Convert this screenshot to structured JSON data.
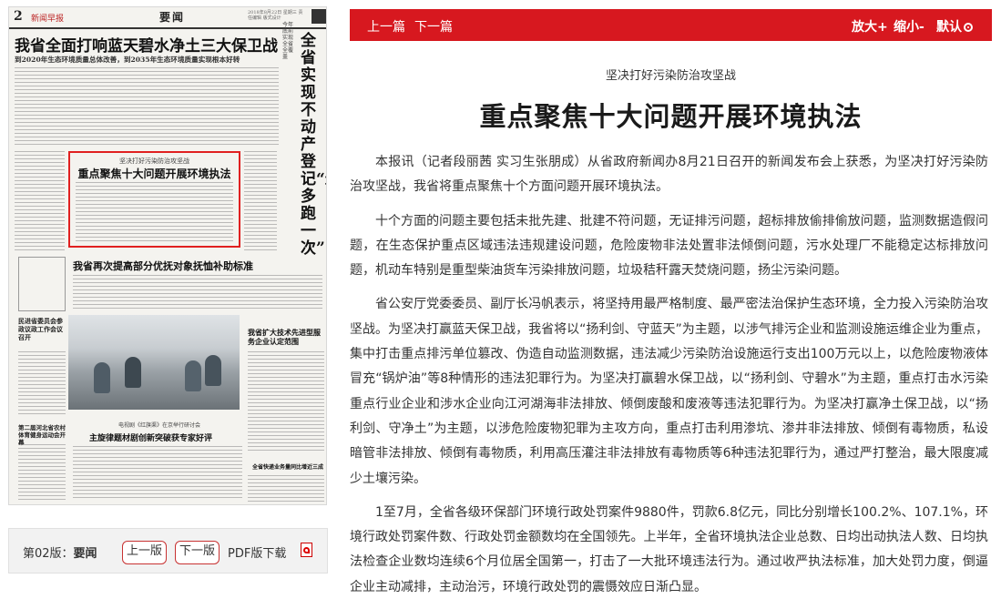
{
  "paper": {
    "page_no": "2",
    "name": "新闻早报",
    "section": "要闻",
    "header_small": "2018年8月22日 星期三 责任编辑 版式设计",
    "lead_headline": "我省全面打响蓝天碧水净土三大保卫战",
    "lead_subhead": "到2020年生态环境质量总体改善，到2035年生态环境质量实现根本好转",
    "vertical_headline": "全省实现不动产登记“最多跑一次”",
    "vertical_sub": "今年底前实现全省全覆盖",
    "highlight_kicker": "坚决打好污染防治攻坚战",
    "highlight_title": "重点聚焦十大问题开展环境执法",
    "third_headline": "我省再次提高部分优抚对象抚恤补助标准",
    "photo_side": "民进省委员会参政议政工作会议召开",
    "right_mid": "我省扩大技术先进型服务企业认定范围",
    "bottom_kicker": "电视剧《红旗渠》在京举行研讨会",
    "bottom_headline": "主旋律题材剧创新突破获专家好评",
    "bottom_right": "全省快递业务量同比增近三成",
    "bottom_left": "第二届河北省农村体育健身运动会开幕"
  },
  "pager": {
    "edition_label": "第02版：",
    "edition_name": "要闻",
    "prev": "上一版",
    "next": "下一版",
    "pdf": "PDF版下载"
  },
  "toolbar": {
    "prev": "上一篇",
    "next": "下一篇",
    "zoom_in": "放大+",
    "zoom_out": "缩小-",
    "default": "默认"
  },
  "article": {
    "kicker": "坚决打好污染防治攻坚战",
    "title": "重点聚焦十大问题开展环境执法",
    "paragraphs": [
      "本报讯（记者段丽茜 实习生张朋成）从省政府新闻办8月21日召开的新闻发布会上获悉，为坚决打好污染防治攻坚战，我省将重点聚焦十个方面问题开展环境执法。",
      "十个方面的问题主要包括未批先建、批建不符问题，无证排污问题，超标排放偷排偷放问题，监测数据造假问题，在生态保护重点区域违法违规建设问题，危险废物非法处置非法倾倒问题，污水处理厂不能稳定达标排放问题，机动车特别是重型柴油货车污染排放问题，垃圾秸秆露天焚烧问题，扬尘污染问题。",
      "省公安厅党委委员、副厅长冯帆表示，将坚持用最严格制度、最严密法治保护生态环境，全力投入污染防治攻坚战。为坚决打赢蓝天保卫战，我省将以“扬利剑、守蓝天”为主题，以涉气排污企业和监测设施运维企业为重点，集中打击重点排污单位篡改、伪造自动监测数据，违法减少污染防治设施运行支出100万元以上，以危险废物液体冒充“锅炉油”等8种情形的违法犯罪行为。为坚决打赢碧水保卫战，以“扬利剑、守碧水”为主题，重点打击水污染重点行业企业和涉水企业向江河湖海非法排放、倾倒废酸和废液等违法犯罪行为。为坚决打赢净土保卫战，以“扬利剑、守净土”为主题，以涉危险废物犯罪为主攻方向，重点打击利用渗坑、渗井非法排放、倾倒有毒物质，私设暗管非法排放、倾倒有毒物质，利用高压灌注非法排放有毒物质等6种违法犯罪行为，通过严打整治，最大限度减少土壤污染。",
      "1至7月，全省各级环保部门环境行政处罚案件9880件，罚款6.8亿元，同比分别增长100.2%、107.1%，环境行政处罚案件数、行政处罚金额数均在全国领先。上半年，全省环境执法企业总数、日均出动执法人数、日均执法检查企业数均连续6个月位居全国第一，打击了一大批环境违法行为。通过收严执法标准，加大处罚力度，倒逼企业主动减排，主动治污，环境行政处罚的震慑效应日渐凸显。"
    ]
  }
}
